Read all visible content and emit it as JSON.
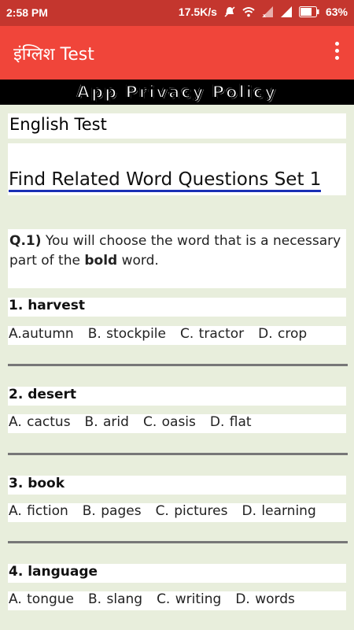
{
  "status": {
    "time": "2:58 PM",
    "speed": "17.5K/s",
    "battery": "63%",
    "icons": [
      "mute-icon",
      "wifi-icon",
      "signal-icon",
      "signal-icon",
      "battery-icon"
    ]
  },
  "appbar": {
    "title": "इंग्लिश Test",
    "menu_icon": "more-vert-icon"
  },
  "banner": {
    "text": "App Privacy Policy"
  },
  "content": {
    "heading": "English Test",
    "set_title": "Find Related Word Questions Set 1",
    "question_label": "Q.1)",
    "question_text_a": " You will choose the word that is a necessary part of the ",
    "question_bold": "bold",
    "question_text_b": " word."
  },
  "questions": [
    {
      "head": "1. harvest",
      "options": [
        "A.autumn",
        "B. stockpile",
        "C. tractor",
        "D. crop"
      ]
    },
    {
      "head": "2. desert",
      "options": [
        "A. cactus",
        "B. arid",
        "C. oasis",
        "D. flat"
      ]
    },
    {
      "head": "3. book",
      "options": [
        "A. fiction",
        "B. pages",
        "C. pictures",
        "D. learning"
      ]
    },
    {
      "head": "4. language",
      "options": [
        "A. tongue",
        "B. slang",
        "C. writing",
        "D. words"
      ]
    }
  ],
  "colors": {
    "statusbar": "#c4362e",
    "appbar": "#f0453a",
    "background": "#e8eedc",
    "link_underline": "#1a2fb5"
  }
}
